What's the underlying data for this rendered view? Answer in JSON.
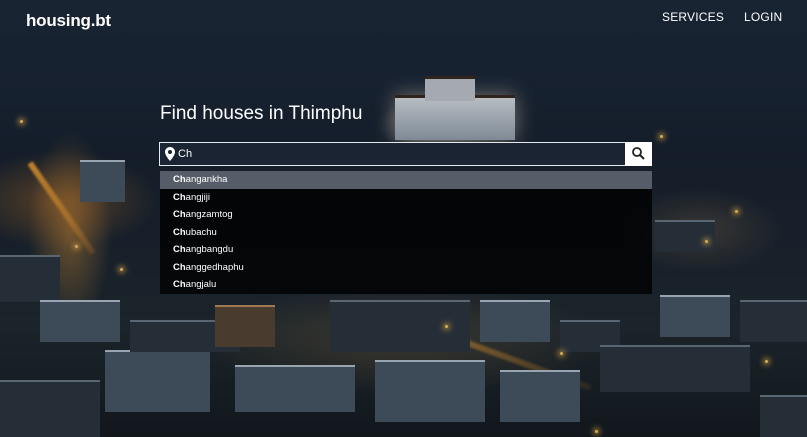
{
  "brand": {
    "logo": "housing.bt"
  },
  "nav": {
    "services": "SERVICES",
    "login": "LOGIN"
  },
  "hero": {
    "heading": "Find houses in Thimphu"
  },
  "search": {
    "value": "Ch",
    "placeholder": ""
  },
  "suggestions": [
    {
      "match": "Ch",
      "rest": "angankha",
      "active": true
    },
    {
      "match": "Ch",
      "rest": "angjiji",
      "active": false
    },
    {
      "match": "Ch",
      "rest": "angzamtog",
      "active": false
    },
    {
      "match": "Ch",
      "rest": "ubachu",
      "active": false
    },
    {
      "match": "Ch",
      "rest": "angbangdu",
      "active": false
    },
    {
      "match": "Ch",
      "rest": "anggedhaphu",
      "active": false
    },
    {
      "match": "Ch",
      "rest": "angjalu",
      "active": false
    }
  ],
  "colors": {
    "text": "#ffffff",
    "highlight_row": "#555e68",
    "dropdown_bg": "#000000"
  },
  "icons": {
    "location": "map-pin-icon",
    "search": "magnifier-icon"
  }
}
